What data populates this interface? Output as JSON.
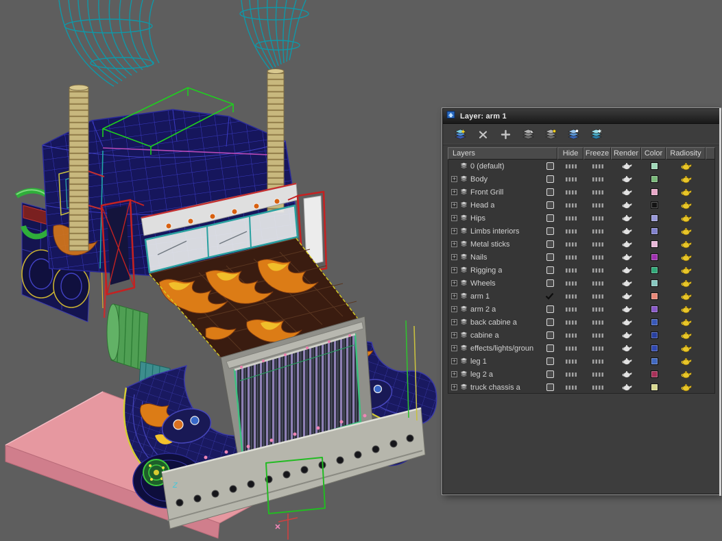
{
  "viewport": {
    "bg_color": "#5e5e5e",
    "axis_label": "Z",
    "content": "wireframe semi-truck model with flame paint, exhaust stacks, pink ground plank, green selection brackets"
  },
  "panel": {
    "title": "Layer: arm 1",
    "expand_glyph": "+",
    "toolbar": [
      {
        "name": "create-new-layer-button",
        "icon": "new-layer"
      },
      {
        "name": "delete-empty-layers-button",
        "icon": "delete-x"
      },
      {
        "name": "add-selection-to-layer-button",
        "icon": "plus"
      },
      {
        "name": "select-layer-objects-button",
        "icon": "select-layer"
      },
      {
        "name": "highlight-selected-objects-layers-button",
        "icon": "highlight-layer"
      },
      {
        "name": "hide-unhide-all-layers-button",
        "icon": "hide-layers"
      },
      {
        "name": "freeze-unfreeze-all-layers-button",
        "icon": "freeze-layers"
      }
    ],
    "columns": [
      {
        "label": "Layers"
      },
      {
        "label": "Hide"
      },
      {
        "label": "Freeze"
      },
      {
        "label": "Render"
      },
      {
        "label": "Color"
      },
      {
        "label": "Radiosity"
      }
    ],
    "rows": [
      {
        "name": "0 (default)",
        "expandable": false,
        "current": false,
        "color": "#a0d8b8"
      },
      {
        "name": "Body",
        "expandable": true,
        "current": false,
        "color": "#78b878"
      },
      {
        "name": "Front Grill",
        "expandable": true,
        "current": false,
        "color": "#e8a8c8"
      },
      {
        "name": "Head a",
        "expandable": true,
        "current": false,
        "color": "#141414"
      },
      {
        "name": "Hips",
        "expandable": true,
        "current": false,
        "color": "#9898d8"
      },
      {
        "name": "Limbs interiors",
        "expandable": true,
        "current": false,
        "color": "#8080cc"
      },
      {
        "name": "Metal sticks",
        "expandable": true,
        "current": false,
        "color": "#e8b8d8"
      },
      {
        "name": "Nails",
        "expandable": true,
        "current": false,
        "color": "#a030b0"
      },
      {
        "name": "Rigging a",
        "expandable": true,
        "current": false,
        "color": "#30a878"
      },
      {
        "name": "Wheels",
        "expandable": true,
        "current": false,
        "color": "#88c8c0"
      },
      {
        "name": "arm 1",
        "expandable": true,
        "current": true,
        "color": "#e88878"
      },
      {
        "name": "arm 2 a",
        "expandable": true,
        "current": false,
        "color": "#8858c8"
      },
      {
        "name": "back cabine a",
        "expandable": true,
        "current": false,
        "color": "#3858b8"
      },
      {
        "name": "cabine a",
        "expandable": true,
        "current": false,
        "color": "#2840a0"
      },
      {
        "name": "effects/lights/groun",
        "expandable": true,
        "current": false,
        "color": "#3048b0"
      },
      {
        "name": "leg 1",
        "expandable": true,
        "current": false,
        "color": "#4068c0"
      },
      {
        "name": "leg 2 a",
        "expandable": true,
        "current": false,
        "color": "#a83058"
      },
      {
        "name": "truck chassis a",
        "expandable": true,
        "current": false,
        "color": "#d8d890"
      }
    ]
  }
}
